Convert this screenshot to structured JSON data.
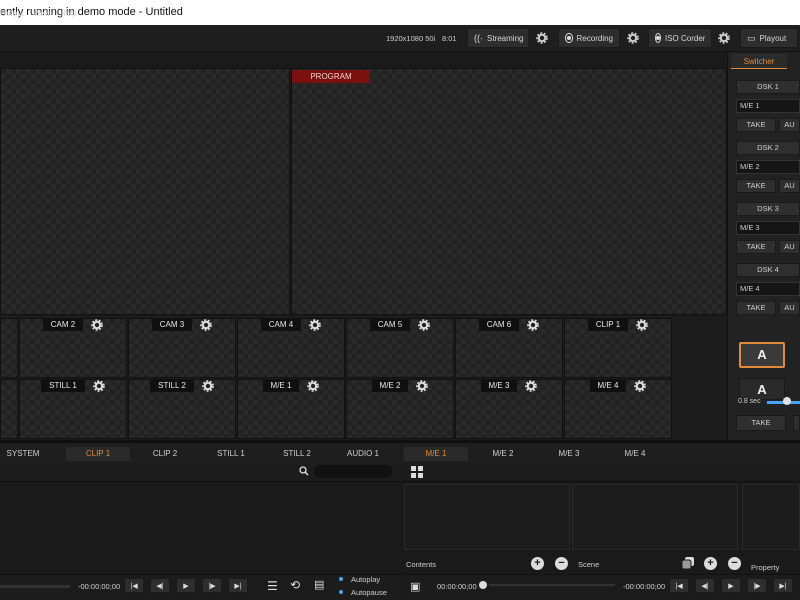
{
  "window": {
    "title": "ently running in demo mode - Untitled"
  },
  "menu": {
    "items": [
      "Output",
      "View",
      "Help"
    ]
  },
  "toolbar": {
    "resolution": "1920x1080 50i",
    "time": "8:01",
    "streaming_label": "Streaming",
    "recording_label": "Recording",
    "isocorder_label": "ISO Corder",
    "playout_label": "Playout"
  },
  "monitors": {
    "program_label": "PROGRAM"
  },
  "inputs": {
    "row1": [
      "CAM 2",
      "CAM 3",
      "CAM 4",
      "CAM 5",
      "CAM 6",
      "CLIP 1"
    ],
    "row2": [
      "STILL 1",
      "STILL 2",
      "M/E 1",
      "M/E 2",
      "M/E 3",
      "M/E 4"
    ]
  },
  "switcher": {
    "tab_label": "Switcher",
    "groups": [
      {
        "dsk": "DSK 1",
        "me": "M/E 1",
        "take": "TAKE",
        "auto": "AU"
      },
      {
        "dsk": "DSK 2",
        "me": "M/E 2",
        "take": "TAKE",
        "auto": "AU"
      },
      {
        "dsk": "DSK 3",
        "me": "M/E 3",
        "take": "TAKE",
        "auto": "AU"
      },
      {
        "dsk": "DSK 4",
        "me": "M/E 4",
        "take": "TAKE",
        "auto": "AU"
      }
    ],
    "a_button": "A",
    "a_button_2": "A",
    "duration": "0.8 sec",
    "take_label": "TAKE"
  },
  "bottom_left": {
    "tabs": [
      "SYSTEM",
      "CLIP 1",
      "CLIP 2",
      "STILL 1",
      "STILL 2",
      "AUDIO 1"
    ],
    "active_tab": "CLIP 1",
    "timecode": "-00:00:00;00",
    "autoplay_label": "Autoplay",
    "autopause_label": "Autopause"
  },
  "bottom_right": {
    "tabs": [
      "M/E 1",
      "M/E 2",
      "M/E 3",
      "M/E 4"
    ],
    "active_tab": "M/E 1",
    "contents_label": "Contents",
    "scene_label": "Scene",
    "property_label": "Property",
    "timecode_start": "00:00:00;00",
    "timecode_end": "-00:00:00;00"
  },
  "colors": {
    "accent": "#e08a3c",
    "program": "#7a1010",
    "autoplay_dot": "#4aa3ff"
  }
}
